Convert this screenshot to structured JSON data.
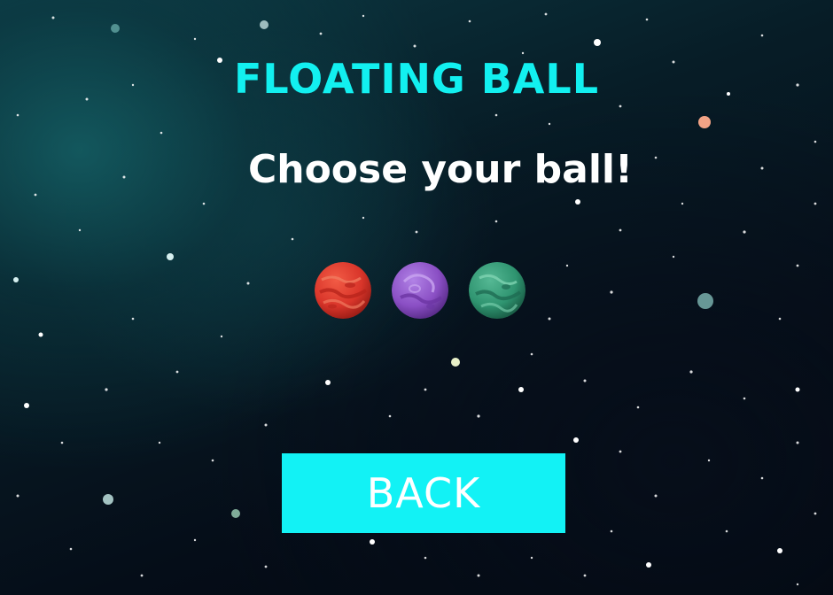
{
  "game": {
    "title": "FLOATING BALL",
    "subtitle": "Choose your ball!"
  },
  "balls": [
    {
      "name": "red-ball",
      "color": "#d9352a"
    },
    {
      "name": "purple-ball",
      "color": "#8a4fc4"
    },
    {
      "name": "green-ball",
      "color": "#2f9470"
    }
  ],
  "back_button": {
    "label": "BACK",
    "color": "#12f2f5"
  },
  "colors": {
    "title": "#12f0f0",
    "subtitle": "#ffffff",
    "background": "#050d18"
  }
}
